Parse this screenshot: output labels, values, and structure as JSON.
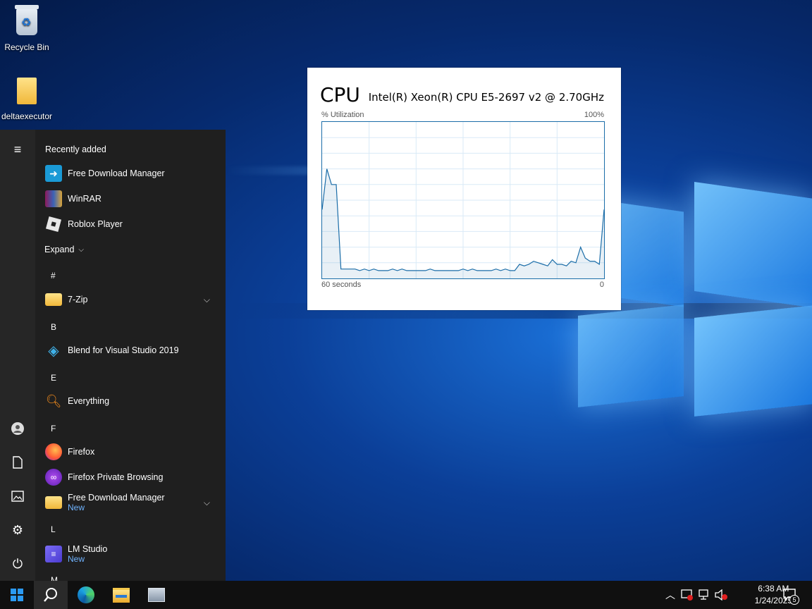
{
  "desktop": {
    "icons": [
      {
        "label": "Recycle Bin",
        "icon": "recycle-bin-icon"
      },
      {
        "label": "deltaexecutor",
        "icon": "folder-icon"
      }
    ]
  },
  "cpu_widget": {
    "title": "CPU",
    "processor": "Intel(R) Xeon(R) CPU E5-2697 v2 @ 2.70GHz",
    "y_label": "% Utilization",
    "y_max_label": "100%",
    "x_left_label": "60 seconds",
    "x_right_label": "0",
    "line_color": "#1b6da8",
    "utilization_series": [
      44,
      70,
      60,
      60,
      6,
      6,
      6,
      6,
      5,
      6,
      5,
      6,
      5,
      5,
      5,
      6,
      5,
      6,
      5,
      5,
      5,
      5,
      5,
      6,
      5,
      5,
      5,
      5,
      5,
      5,
      6,
      5,
      6,
      5,
      5,
      5,
      5,
      6,
      5,
      6,
      5,
      5,
      9,
      8,
      9,
      11,
      10,
      9,
      8,
      12,
      9,
      9,
      8,
      11,
      10,
      20,
      13,
      11,
      11,
      9,
      44
    ]
  },
  "start_menu": {
    "recently_added_label": "Recently added",
    "recent_apps": [
      {
        "label": "Free Download Manager",
        "icon": "free-download-manager-icon"
      },
      {
        "label": "WinRAR",
        "icon": "winrar-icon"
      },
      {
        "label": "Roblox Player",
        "icon": "roblox-icon"
      }
    ],
    "expand_label": "Expand",
    "groups": [
      {
        "letter": "#",
        "apps": [
          {
            "label": "7-Zip",
            "icon": "folder-icon",
            "expandable": true
          }
        ]
      },
      {
        "letter": "B",
        "apps": [
          {
            "label": "Blend for Visual Studio 2019",
            "icon": "blend-icon"
          }
        ]
      },
      {
        "letter": "E",
        "apps": [
          {
            "label": "Everything",
            "icon": "search-magnifier-icon"
          }
        ]
      },
      {
        "letter": "F",
        "apps": [
          {
            "label": "Firefox",
            "icon": "firefox-icon"
          },
          {
            "label": "Firefox Private Browsing",
            "icon": "firefox-private-icon"
          },
          {
            "label": "Free Download Manager",
            "sub": "New",
            "icon": "folder-icon",
            "expandable": true
          }
        ]
      },
      {
        "letter": "L",
        "apps": [
          {
            "label": "LM Studio",
            "sub": "New",
            "icon": "lm-studio-icon"
          }
        ]
      },
      {
        "letter": "M",
        "apps": []
      }
    ]
  },
  "taskbar": {
    "time": "6:38 AM",
    "date": "1/24/2025",
    "notification_count": "5"
  }
}
